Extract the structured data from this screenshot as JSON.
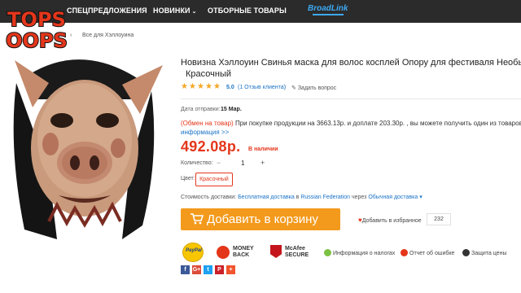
{
  "nav": {
    "items": [
      {
        "label": "СПЕЦПРЕДЛОЖЕНИЯ",
        "chevron": false
      },
      {
        "label": "НОВИНКИ",
        "chevron": true
      },
      {
        "label": "ОТБОРНЫЕ ТОВАРЫ",
        "chevron": false
      }
    ],
    "brand": "BroadLink"
  },
  "logo": {
    "line1": "TOPS",
    "line2": "OOPS"
  },
  "breadcrumb": [
    "‹",
    "Все для Хэллоуина"
  ],
  "product": {
    "title": "Новизна Хэллоуин Свинья маска для волос косплей Опору для фестиваля Необычн",
    "title_line2": "Красочный",
    "rating": "5.0",
    "reviews": "(1 Отзыв клиента)",
    "ask": "Задать вопрос",
    "ship_label": "Дата отправки:",
    "ship_date": "15 Мар.",
    "promo_link": "(Обмен на товар)",
    "promo_text": " При покупке продукции на 3663.13р.  и доплате 203.30р. , вы можете получить один из товаров",
    "promo_more": "информация >>",
    "price": "492.08р.",
    "stock": "В наличии",
    "qty_label": "Количество:",
    "qty_minus": "−",
    "qty_value": "1",
    "qty_plus": "+",
    "color_label": "Цвет:",
    "color_value": "Красочный",
    "delivery_label": "Стоимость доставки:",
    "delivery_free": "Бесплатная доставка",
    "delivery_to": " в ",
    "delivery_country": "Russian Federation",
    "delivery_via": " через ",
    "delivery_method": "Обычная доставка",
    "cart_label": "Добавить в корзину",
    "wish_label": "Добавить в избранное",
    "wish_count": "232"
  },
  "badges": {
    "paypal": "PayPal",
    "money": [
      "MONEY",
      "BACK"
    ],
    "mcafee": [
      "McAfee",
      "SECURE"
    ],
    "info": [
      {
        "label": "Информация о налогах",
        "color": "#7cc242"
      },
      {
        "label": "Отчет об ошибке",
        "color": "#e4361b"
      },
      {
        "label": "Защита цены",
        "color": "#333333"
      }
    ]
  },
  "social": [
    {
      "label": "f",
      "color": "#3b5998"
    },
    {
      "label": "G+",
      "color": "#dd4b39"
    },
    {
      "label": "t",
      "color": "#1da1f2"
    },
    {
      "label": "P",
      "color": "#cb2027"
    },
    {
      "label": "+",
      "color": "#f2542d"
    }
  ],
  "colors": {
    "accent": "#e4361b",
    "cart": "#f39a1c",
    "link": "#1a73c7",
    "nav_bg": "#2b2b2b"
  }
}
